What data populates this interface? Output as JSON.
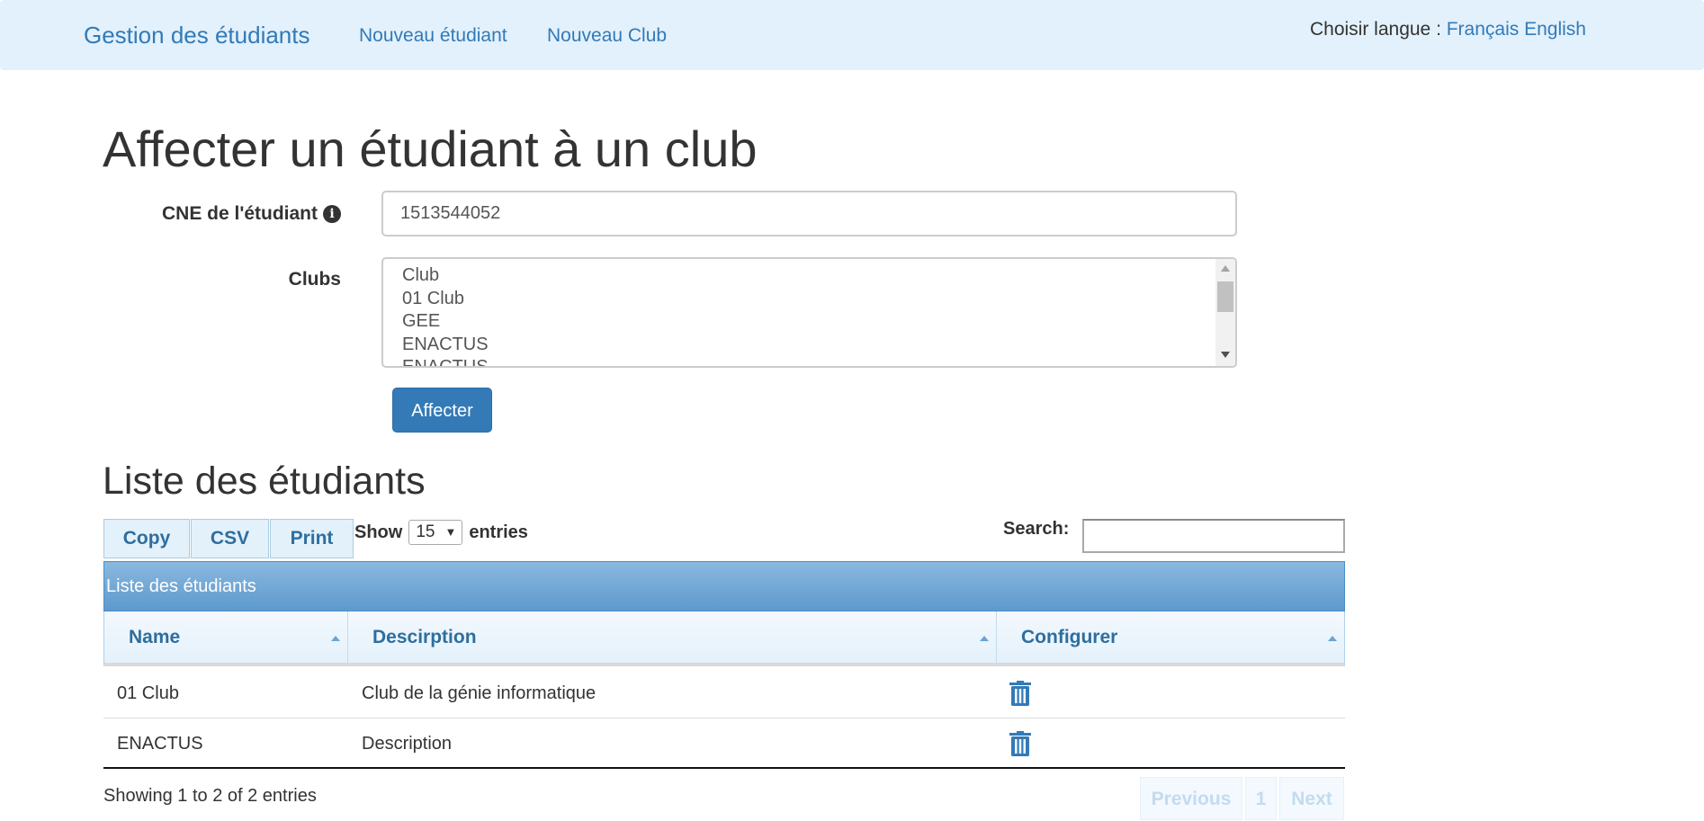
{
  "navbar": {
    "brand": "Gestion des étudiants",
    "links": [
      "Nouveau étudiant",
      "Nouveau Club"
    ],
    "lang_label": "Choisir langue : ",
    "lang_options": [
      "Français",
      "English"
    ]
  },
  "form": {
    "title": "Affecter un étudiant à un club",
    "cne_label": "CNE de l'étudiant",
    "cne_value": "1513544052",
    "clubs_label": "Clubs",
    "clubs_options": [
      "Club",
      "01 Club",
      "GEE",
      "ENACTUS",
      "ENACTUS"
    ],
    "submit_label": "Affecter"
  },
  "list": {
    "title": "Liste des étudiants",
    "buttons": [
      "Copy",
      "CSV",
      "Print"
    ],
    "show_label": "Show",
    "page_length": "15",
    "entries_label": "entries",
    "search_label": "Search:",
    "caption": "Liste des étudiants",
    "columns": [
      "Name",
      "Descirption",
      "Configurer"
    ],
    "rows": [
      {
        "name": "01 Club",
        "description": "Club de la génie informatique",
        "action_icon": "trash-icon"
      },
      {
        "name": "ENACTUS",
        "description": "Description",
        "action_icon": "trash-icon"
      }
    ],
    "info": "Showing 1 to 2 of 2 entries",
    "pagination": {
      "previous": "Previous",
      "page": "1",
      "next": "Next"
    }
  },
  "colors": {
    "navbar_bg": "#e2f1fc",
    "link": "#337ab7",
    "primary_button": "#337ab7",
    "table_header_text": "#2e6e9e",
    "caption_bg": "#74a9d6"
  }
}
